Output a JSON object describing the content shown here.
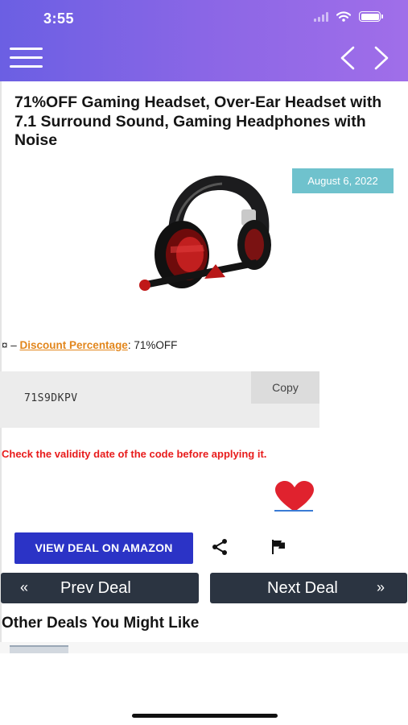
{
  "status_bar": {
    "time": "3:55"
  },
  "post": {
    "title": "71%OFF Gaming Headset, Over-Ear Headset with 7.1 Surround Sound, Gaming Headphones with Noise",
    "date": "August 6, 2022",
    "discount": {
      "prefix": "¤ – ",
      "label": "Discount Percentage",
      "value": ": 71%OFF"
    },
    "coupon": {
      "code": "71S9DKPV",
      "copy_label": "Copy"
    },
    "warning": "Check the validity date of the code before applying it.",
    "view_deal_label": "VIEW DEAL ON AMAZON",
    "prev_label": "Prev Deal",
    "next_label": "Next Deal",
    "prev_chevron": "«",
    "next_chevron": "»"
  },
  "other_deals": {
    "title": "Other Deals You Might Like"
  },
  "icons": {
    "menu": "hamburger-icon",
    "back": "chevron-left-icon",
    "forward": "chevron-right-icon",
    "favorite": "heart-icon",
    "share": "share-icon",
    "report": "flag-icon"
  },
  "colors": {
    "header_start": "#6b5fe3",
    "header_end": "#a06ee9",
    "date_badge": "#6fc2cd",
    "discount_link": "#e2861c",
    "warning": "#e81c1c",
    "heart": "#e0222e",
    "amazon_button": "#2b33c6",
    "deal_nav": "#2b3441"
  }
}
